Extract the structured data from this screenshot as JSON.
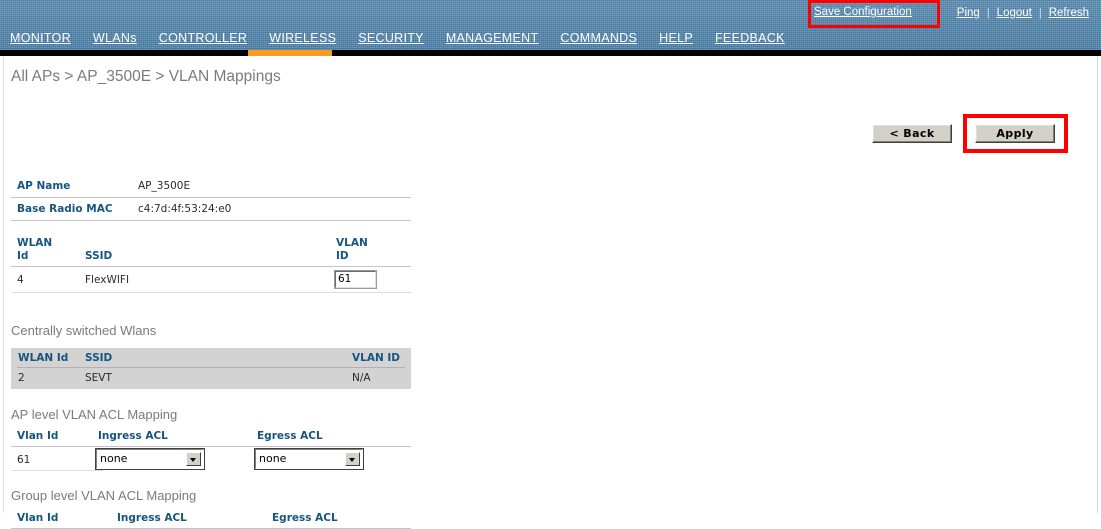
{
  "header": {
    "utility_links": [
      {
        "label": "Ping",
        "name": "ping-link"
      },
      {
        "label": "Logout",
        "name": "logout-link"
      },
      {
        "label": "Refresh",
        "name": "refresh-link"
      }
    ],
    "separator": "|",
    "save_configuration": "Save Configuration",
    "nav_items": [
      {
        "label": "MONITOR"
      },
      {
        "label": "WLANs"
      },
      {
        "label": "CONTROLLER"
      },
      {
        "label": "WIRELESS"
      },
      {
        "label": "SECURITY"
      },
      {
        "label": "MANAGEMENT"
      },
      {
        "label": "COMMANDS"
      },
      {
        "label": "HELP"
      },
      {
        "label": "FEEDBACK"
      }
    ],
    "active_nav": "WIRELESS"
  },
  "page": {
    "breadcrumb": "All APs > AP_3500E > VLAN Mappings",
    "back_button": "< Back",
    "apply_button": "Apply"
  },
  "ap_info": {
    "ap_name_label": "AP Name",
    "ap_name_value": "AP_3500E",
    "base_radio_mac_label": "Base Radio MAC",
    "base_radio_mac_value": "c4:7d:4f:53:24:e0"
  },
  "local_wlan_table": {
    "headers": {
      "wlan_id_line1": "WLAN",
      "wlan_id_line2": "Id",
      "ssid": "SSID",
      "vlan_id_line1": "VLAN",
      "vlan_id_line2": "ID"
    },
    "rows": [
      {
        "wlan_id": "4",
        "ssid": "FlexWIFI",
        "vlan_id": "61"
      }
    ]
  },
  "central_wlan_table": {
    "title": "Centrally switched Wlans",
    "headers": {
      "wlan_id": "WLAN Id",
      "ssid": "SSID",
      "vlan_id": "VLAN ID"
    },
    "rows": [
      {
        "wlan_id": "2",
        "ssid": "SEVT",
        "vlan_id": "N/A"
      }
    ]
  },
  "ap_acl_table": {
    "title": "AP level VLAN ACL Mapping",
    "headers": {
      "vlan_id": "Vlan Id",
      "ingress_acl": "Ingress ACL",
      "egress_acl": "Egress ACL"
    },
    "rows": [
      {
        "vlan_id": "61",
        "ingress_acl": "none",
        "egress_acl": "none"
      }
    ]
  },
  "group_acl_table": {
    "title": "Group level VLAN ACL Mapping",
    "headers": {
      "vlan_id": "Vlan Id",
      "ingress_acl": "Ingress ACL",
      "egress_acl": "Egress ACL"
    },
    "rows": []
  },
  "colors": {
    "banner_blue": "#5287ae",
    "accent_orange": "#f79b21",
    "highlight_red": "#ff0000",
    "table_header_blue": "#15557f",
    "gray_table": "#d3d3d3"
  }
}
